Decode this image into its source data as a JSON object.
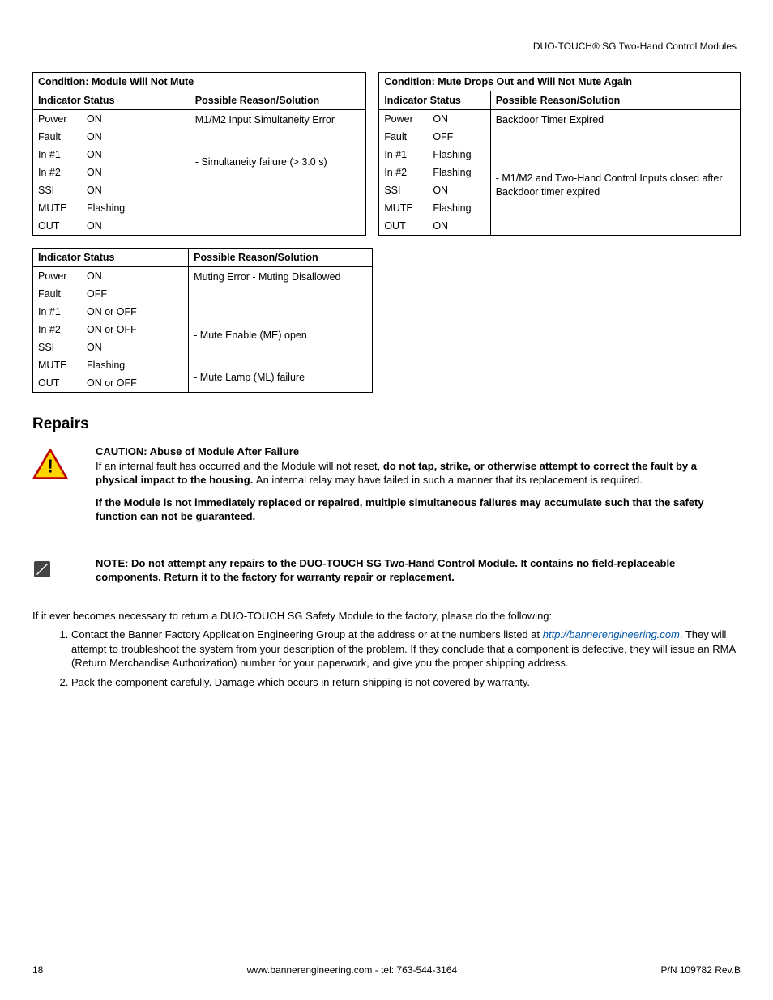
{
  "header": {
    "product": "DUO-TOUCH® SG Two-Hand Control Modules"
  },
  "tables": {
    "t1": {
      "condition": "Condition: Module Will Not Mute",
      "hdr_indicator": "Indicator Status",
      "hdr_reason": "Possible Reason/Solution",
      "rows": [
        {
          "ind": "Power",
          "st": "ON"
        },
        {
          "ind": "Fault",
          "st": "ON"
        },
        {
          "ind": "In #1",
          "st": "ON"
        },
        {
          "ind": "In #2",
          "st": "ON"
        },
        {
          "ind": "SSI",
          "st": "ON"
        },
        {
          "ind": "MUTE",
          "st": "Flashing"
        },
        {
          "ind": "OUT",
          "st": "ON"
        }
      ],
      "reason1": "M1/M2 Input Simultaneity Error",
      "reason2": "- Simultaneity failure (> 3.0 s)"
    },
    "t2": {
      "condition": "Condition: Mute Drops Out and Will Not Mute Again",
      "hdr_indicator": "Indicator Status",
      "hdr_reason": "Possible Reason/Solution",
      "rows": [
        {
          "ind": "Power",
          "st": "ON"
        },
        {
          "ind": "Fault",
          "st": "OFF"
        },
        {
          "ind": "In #1",
          "st": "Flashing"
        },
        {
          "ind": "In #2",
          "st": "Flashing"
        },
        {
          "ind": "SSI",
          "st": "ON"
        },
        {
          "ind": "MUTE",
          "st": "Flashing"
        },
        {
          "ind": "OUT",
          "st": "ON"
        }
      ],
      "reason1": "Backdoor Timer Expired",
      "reason2": "- M1/M2 and Two-Hand Control Inputs closed after Backdoor timer expired"
    },
    "t3": {
      "hdr_indicator": "Indicator Status",
      "hdr_reason": "Possible Reason/Solution",
      "rows": [
        {
          "ind": "Power",
          "st": "ON"
        },
        {
          "ind": "Fault",
          "st": "OFF"
        },
        {
          "ind": "In #1",
          "st": "ON or OFF"
        },
        {
          "ind": "In #2",
          "st": "ON or OFF"
        },
        {
          "ind": "SSI",
          "st": "ON"
        },
        {
          "ind": "MUTE",
          "st": "Flashing"
        },
        {
          "ind": "OUT",
          "st": "ON or OFF"
        }
      ],
      "reason1": "Muting Error - Muting Disallowed",
      "reason2": "- Mute Enable (ME) open",
      "reason3": "- Mute Lamp (ML) failure"
    }
  },
  "repairs": {
    "heading": "Repairs",
    "caution_title": "CAUTION: Abuse of Module After Failure",
    "caution_p1a": "If an internal fault has occurred and the Module will not reset, ",
    "caution_p1b": "do not tap, strike, or otherwise attempt to correct the fault by a physical impact to the housing. ",
    "caution_p1c": "An internal relay may have failed in such a manner that its replacement is required.",
    "caution_p2": "If the Module is not immediately replaced or repaired, multiple simultaneous failures may accumulate such that the safety function can not be guaranteed.",
    "note": "NOTE: Do not attempt any repairs to the DUO-TOUCH SG Two-Hand Control Module. It contains no field-replaceable components. Return it to the factory for warranty repair or replacement.",
    "para": "If it ever becomes necessary to return a DUO-TOUCH SG Safety Module to the factory, please do the following:",
    "step1a": "Contact the Banner Factory Application Engineering Group at the address or at the numbers listed at ",
    "step1_link": "http://bannerengineering.com",
    "step1b": ". They will attempt to troubleshoot the system from your description of the problem. If they conclude that a component is defective, they will issue an RMA (Return Merchandise Authorization) number for your paperwork, and give you the proper shipping address.",
    "step2": "Pack the component carefully. Damage which occurs in return shipping is not covered by warranty."
  },
  "footer": {
    "page": "18",
    "center": "www.bannerengineering.com - tel: 763-544-3164",
    "right": "P/N 109782 Rev.B"
  }
}
